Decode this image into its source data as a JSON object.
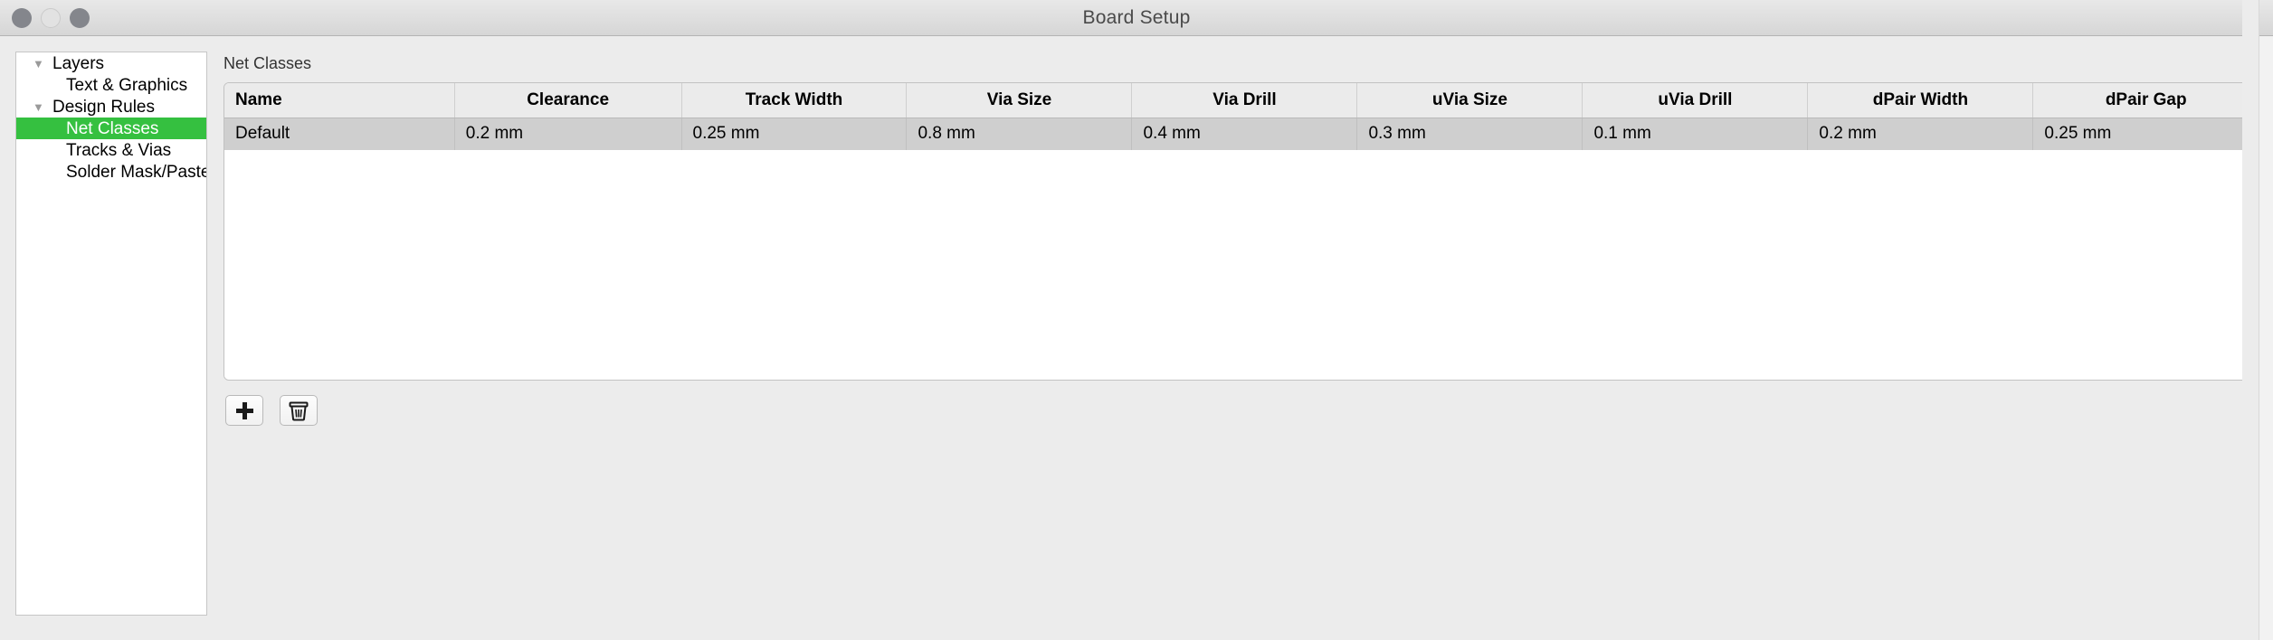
{
  "window": {
    "title": "Board Setup",
    "traffic_lights": [
      {
        "name": "close-button",
        "color": "#84868c"
      },
      {
        "name": "minimize-button",
        "color": "#e2e2e2"
      },
      {
        "name": "maximize-button",
        "color": "#84868c"
      }
    ]
  },
  "sidebar": {
    "items": [
      {
        "label": "Layers",
        "level": 0,
        "disclosure": "▼",
        "selected": false
      },
      {
        "label": "Text & Graphics",
        "level": 1,
        "disclosure": "",
        "selected": false
      },
      {
        "label": "Design Rules",
        "level": 0,
        "disclosure": "▼",
        "selected": false
      },
      {
        "label": "Net Classes",
        "level": 1,
        "disclosure": "",
        "selected": true
      },
      {
        "label": "Tracks & Vias",
        "level": 1,
        "disclosure": "",
        "selected": false
      },
      {
        "label": "Solder Mask/Paste",
        "level": 1,
        "disclosure": "",
        "selected": false
      }
    ],
    "selection_color": "#35c040"
  },
  "main": {
    "section_label": "Net Classes",
    "table": {
      "columns": [
        "Name",
        "Clearance",
        "Track Width",
        "Via Size",
        "Via Drill",
        "uVia Size",
        "uVia Drill",
        "dPair Width",
        "dPair Gap"
      ],
      "rows": [
        {
          "name": "Default",
          "clearance": "0.2 mm",
          "track_width": "0.25 mm",
          "via_size": "0.8 mm",
          "via_drill": "0.4 mm",
          "uvia_size": "0.3 mm",
          "uvia_drill": "0.1 mm",
          "dpair_width": "0.2 mm",
          "dpair_gap": "0.25 mm",
          "selected": true
        }
      ],
      "selected_row_color": "#cfcfcf",
      "header_color": "#ebebeb"
    },
    "buttons": [
      {
        "name": "add-net-class-button",
        "icon": "plus-icon",
        "label": ""
      },
      {
        "name": "delete-net-class-button",
        "icon": "trash-icon",
        "label": ""
      }
    ]
  }
}
